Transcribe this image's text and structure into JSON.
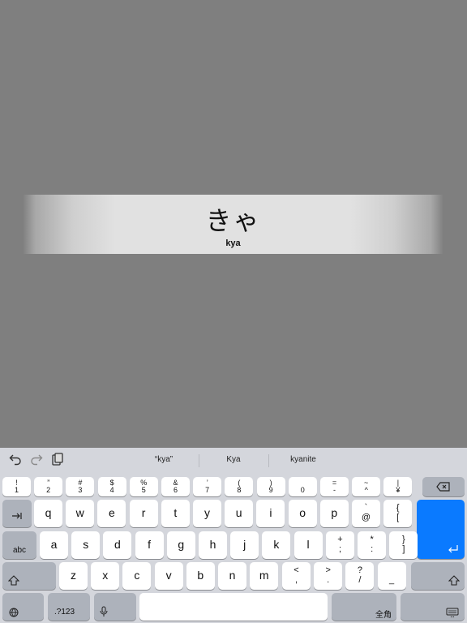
{
  "card": {
    "kana": "きゃ",
    "romaji": "kya"
  },
  "toolbar": {
    "undo_icon": "undo-icon",
    "redo_icon": "redo-icon",
    "paste_icon": "clipboard-icon",
    "suggestions": [
      "“kya”",
      "Kya",
      "kyanite"
    ]
  },
  "keys": {
    "num_row": [
      {
        "top": "!",
        "bot": "1"
      },
      {
        "top": "”",
        "bot": "2"
      },
      {
        "top": "#",
        "bot": "3"
      },
      {
        "top": "$",
        "bot": "4"
      },
      {
        "top": "%",
        "bot": "5"
      },
      {
        "top": "&",
        "bot": "6"
      },
      {
        "top": "’",
        "bot": "7"
      },
      {
        "top": "(",
        "bot": "8"
      },
      {
        "top": ")",
        "bot": "9"
      },
      {
        "top": "",
        "bot": "0"
      },
      {
        "top": "=",
        "bot": "-"
      },
      {
        "top": "~",
        "bot": "^"
      },
      {
        "top": "|",
        "bot": "¥"
      }
    ],
    "row_q": [
      "q",
      "w",
      "e",
      "r",
      "t",
      "y",
      "u",
      "i",
      "o",
      "p"
    ],
    "row_q_sym": [
      {
        "top": "`",
        "bot": "@"
      },
      {
        "top": "{",
        "bot": "["
      }
    ],
    "row_a": [
      "a",
      "s",
      "d",
      "f",
      "g",
      "h",
      "j",
      "k",
      "l"
    ],
    "row_a_sym": [
      {
        "top": "+",
        "bot": ";"
      },
      {
        "top": "*",
        "bot": ":"
      },
      {
        "top": "}",
        "bot": "]"
      }
    ],
    "row_z": [
      "z",
      "x",
      "c",
      "v",
      "b",
      "n",
      "m"
    ],
    "row_z_sym": [
      {
        "top": "<",
        "bot": ","
      },
      {
        "top": ">",
        "bot": "."
      },
      {
        "top": "?",
        "bot": "/"
      },
      {
        "top": "",
        "bot": "_"
      }
    ],
    "abc_label": "abc",
    "numbers_label": ".?123",
    "zenkaku_label": "全角"
  },
  "colors": {
    "background": "#7f7f7f",
    "keyboard": "#d4d6dc",
    "return_key": "#0a7aff"
  }
}
